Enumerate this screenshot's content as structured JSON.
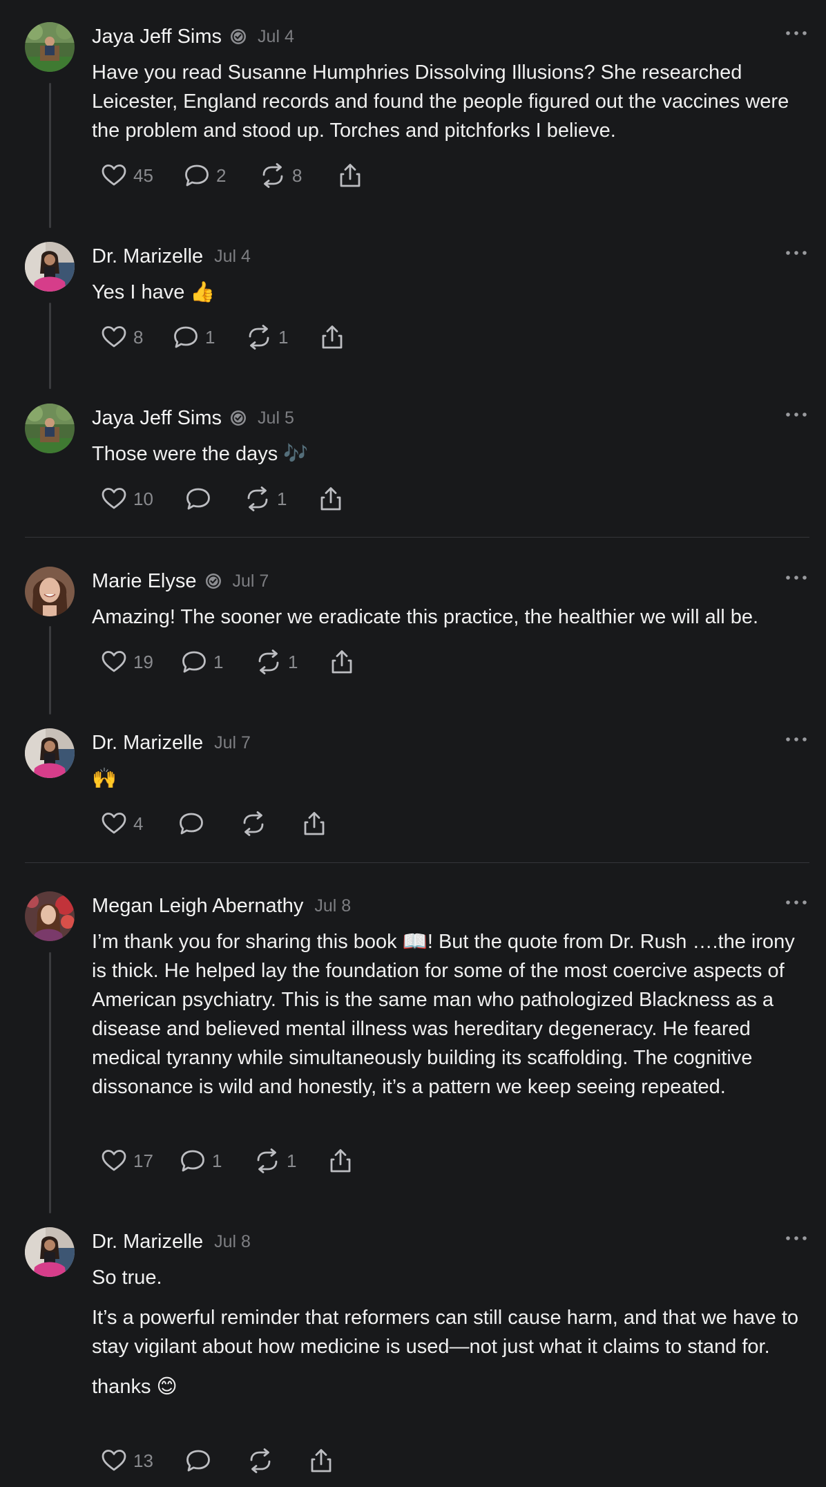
{
  "posts": [
    {
      "author": "Jaya Jeff Sims",
      "verified": true,
      "date": "Jul 4",
      "avatar": "avatar-outdoor-man-chair",
      "paragraphs": [
        "Have you read Susanne Humphries Dissolving Illusions? She researched Leicester, England records and found the people figured out the vaccines were the problem and stood up. Torches and pitchforks I believe."
      ],
      "likes": "45",
      "comments": "2",
      "reposts": "8"
    },
    {
      "author": "Dr. Marizelle",
      "verified": false,
      "date": "Jul 4",
      "avatar": "avatar-woman-pink",
      "paragraphs": [
        "Yes I have 👍"
      ],
      "likes": "8",
      "comments": "1",
      "reposts": "1"
    },
    {
      "author": "Jaya Jeff Sims",
      "verified": true,
      "date": "Jul 5",
      "avatar": "avatar-outdoor-man-chair",
      "paragraphs": [
        "Those were the days 🎶"
      ],
      "likes": "10",
      "comments": "",
      "reposts": "1"
    },
    {
      "author": "Marie Elyse",
      "verified": true,
      "date": "Jul 7",
      "avatar": "avatar-woman-smiling",
      "paragraphs": [
        "Amazing! The sooner we eradicate this practice, the healthier we will all be."
      ],
      "likes": "19",
      "comments": "1",
      "reposts": "1"
    },
    {
      "author": "Dr. Marizelle",
      "verified": false,
      "date": "Jul 7",
      "avatar": "avatar-woman-pink",
      "paragraphs": [
        "🙌"
      ],
      "likes": "4",
      "comments": "",
      "reposts": ""
    },
    {
      "author": "Megan Leigh Abernathy",
      "verified": false,
      "date": "Jul 8",
      "avatar": "avatar-woman-flowers",
      "paragraphs": [
        "I’m thank you for sharing this book 📖! But the quote from Dr. Rush ….the irony is thick. He helped lay the foundation for some of the most coercive aspects of American psychiatry. This is the same man who pathologized Blackness as a disease and believed mental illness was hereditary degeneracy. He feared medical tyranny while simultaneously building its scaffolding. The cognitive dissonance is wild and honestly, it’s a pattern we keep seeing repeated."
      ],
      "likes": "17",
      "comments": "1",
      "reposts": "1"
    },
    {
      "author": "Dr. Marizelle",
      "verified": false,
      "date": "Jul 8",
      "avatar": "avatar-woman-pink",
      "paragraphs": [
        "So true.",
        "It’s a powerful reminder that reformers can still cause harm, and that we have to stay vigilant about how medicine is used—not just what it claims to stand for.",
        "thanks 😊"
      ],
      "likes": "13",
      "comments": "",
      "reposts": ""
    }
  ],
  "icons": {
    "like": "heart-icon",
    "comment": "comment-icon",
    "repost": "repost-icon",
    "share": "share-icon",
    "more": "more-options-icon",
    "verified": "verified-badge-icon"
  },
  "colors": {
    "background": "#18191b",
    "text": "#f0f0f0",
    "muted": "#7d7e82",
    "thread_line": "#3a3b3e"
  }
}
